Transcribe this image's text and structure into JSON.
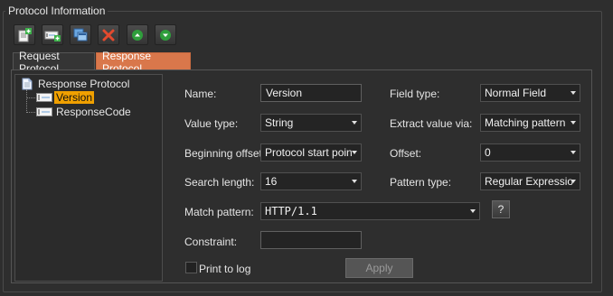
{
  "group": {
    "title": "Protocol Information"
  },
  "toolbar": {
    "buttons": [
      {
        "name": "add-icon"
      },
      {
        "name": "insert-field-icon"
      },
      {
        "name": "copy-icon"
      },
      {
        "name": "delete-icon"
      },
      {
        "name": "move-up-icon"
      },
      {
        "name": "move-down-icon"
      }
    ]
  },
  "tabs": {
    "request": "Request Protocol",
    "response": "Response Protocol",
    "active": "response"
  },
  "tree": {
    "root": "Response Protocol",
    "children": [
      "Version",
      "ResponseCode"
    ],
    "selected": "Version"
  },
  "form": {
    "name_label": "Name:",
    "name_value": "Version",
    "field_type_label": "Field type:",
    "field_type_value": "Normal Field",
    "value_type_label": "Value type:",
    "value_type_value": "String",
    "extract_label": "Extract value via:",
    "extract_value": "Matching pattern",
    "beginning_offset_label": "Beginning offset:",
    "beginning_offset_value": "Protocol start poin",
    "offset_label": "Offset:",
    "offset_value": "0",
    "search_length_label": "Search length:",
    "search_length_value": "16",
    "pattern_type_label": "Pattern type:",
    "pattern_type_value": "Regular Expressio",
    "match_pattern_label": "Match pattern:",
    "match_pattern_value": "HTTP/1.1",
    "help_label": "?",
    "constraint_label": "Constraint:",
    "constraint_value": "",
    "print_to_log_label": "Print to log",
    "print_to_log_checked": false,
    "apply_label": "Apply"
  },
  "colors": {
    "active_tab": "#d9774b",
    "selection": "#f0a000",
    "background": "#2e2e2e"
  }
}
